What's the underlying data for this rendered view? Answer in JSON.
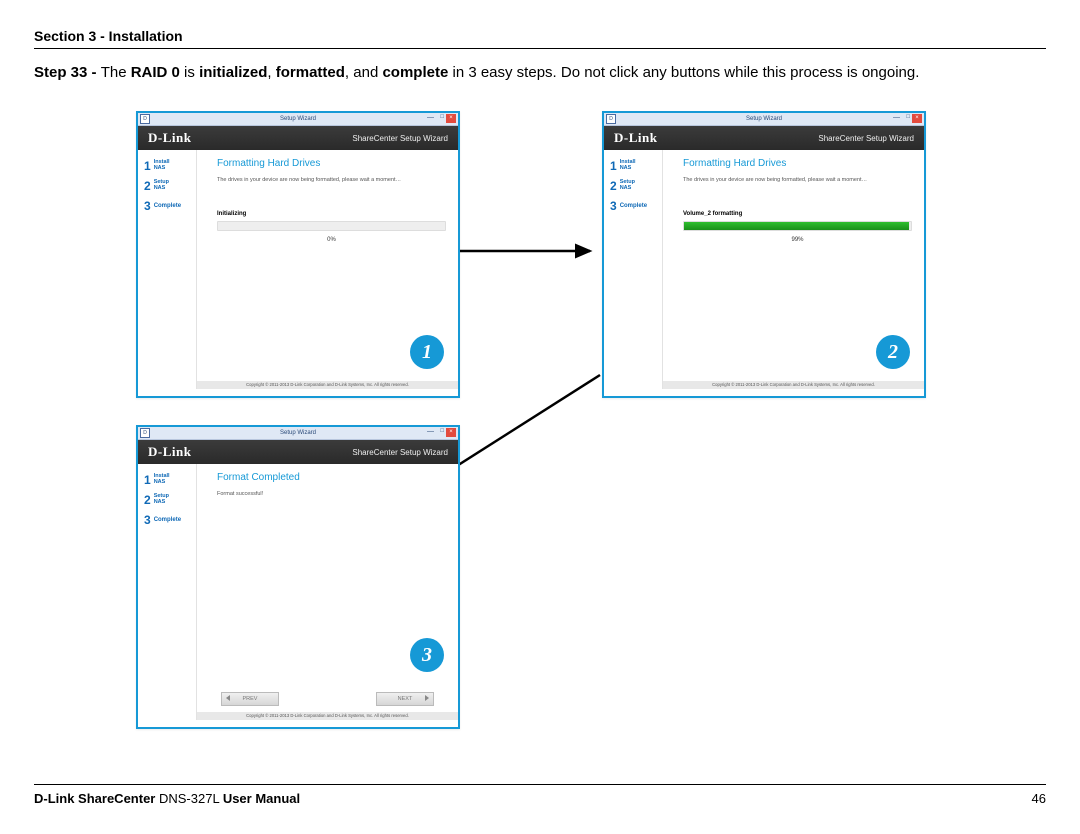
{
  "header": {
    "section": "Section 3 - Installation"
  },
  "step": {
    "prefix": "Step 33 - ",
    "text_1": "The ",
    "bold_1": "RAID 0",
    "text_2": " is ",
    "bold_2": "initialized",
    "text_3": ", ",
    "bold_3": "formatted",
    "text_4": ", and ",
    "bold_4": "complete",
    "text_5": " in 3 easy steps. Do not click any buttons while this process is ongoing."
  },
  "common": {
    "titlebar": "Setup Wizard",
    "titlebar_icon": "D",
    "close": "×",
    "minimize": "—",
    "maximize": "□",
    "brand": "D-Link",
    "wizard_label": "ShareCenter Setup Wizard",
    "steps": [
      {
        "num": "1",
        "line1": "Install",
        "line2": "NAS"
      },
      {
        "num": "2",
        "line1": "Setup",
        "line2": "NAS"
      },
      {
        "num": "3",
        "line1": "Complete",
        "line2": ""
      }
    ],
    "copyright": "Copyright © 2011-2013 D-Link Corporation and D-Link Systems, Inc. All rights reserved."
  },
  "panel1": {
    "title": "Formatting Hard Drives",
    "sub": "The drives in your device are now being formatted, please wait a moment…",
    "status": "Initializing",
    "pct": "0%",
    "progress": 0,
    "badge": "1"
  },
  "panel2": {
    "title": "Formatting Hard Drives",
    "sub": "The drives in your device are now being formatted, please wait a moment…",
    "status": "Volume_2 formatting",
    "pct": "99%",
    "progress": 99,
    "badge": "2"
  },
  "panel3": {
    "title": "Format Completed",
    "sub": "Format successful!",
    "prev": "PREV",
    "next": "NEXT",
    "badge": "3"
  },
  "footer": {
    "product_bold1": "D-Link ShareCenter",
    "product_rest": " DNS-327L ",
    "product_bold2": "User Manual",
    "page": "46"
  }
}
